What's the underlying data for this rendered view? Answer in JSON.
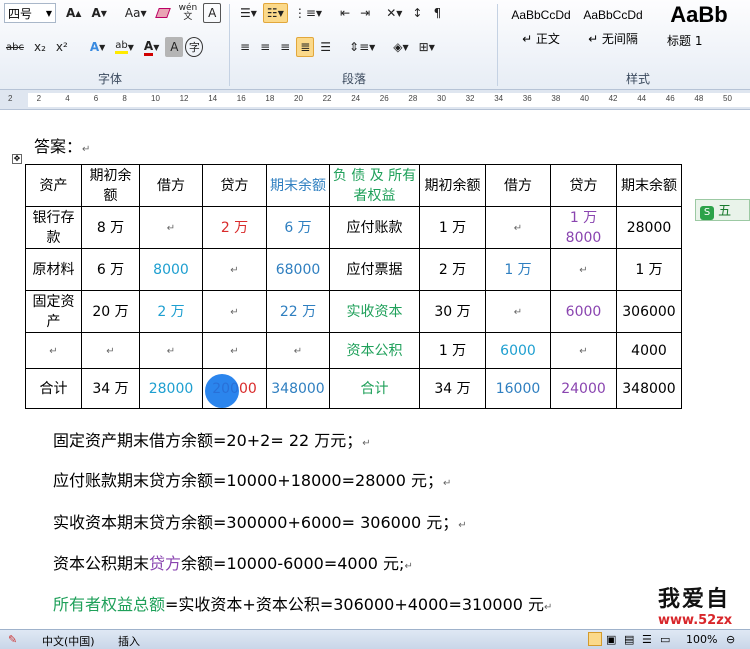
{
  "ribbon": {
    "font_size": "四号",
    "group_font": "字体",
    "group_paragraph": "段落",
    "group_styles": "样式",
    "styles": [
      {
        "sample": "AaBbCcDd",
        "name": "↵ 正文"
      },
      {
        "sample": "AaBbCcDd",
        "name": "↵ 无间隔"
      },
      {
        "sample": "AaBb",
        "name": "标题 1"
      }
    ],
    "buttons": {
      "grow_font": "A",
      "shrink_font": "A",
      "change_case": "Aa",
      "wen": "wén",
      "char_border": "A",
      "strike": "abc",
      "subscript": "x₂",
      "superscript": "x²",
      "text_effect": "A",
      "font_color": "A",
      "char_shade": "A",
      "enclose": "字",
      "highlight": "ab"
    }
  },
  "ruler": {
    "ticks": [
      "2",
      "2",
      "4",
      "6",
      "8",
      "10",
      "12",
      "14",
      "16",
      "18",
      "20",
      "22",
      "24",
      "26",
      "28",
      "30",
      "32",
      "34",
      "36",
      "38",
      "40",
      "42",
      "44",
      "46",
      "48",
      "50"
    ]
  },
  "doc": {
    "answer_label": "答案：",
    "table": {
      "header": [
        "资产",
        "期初余额",
        "借方",
        "贷方",
        "期末余额",
        "负 债 及 所有者权益",
        "期初余额",
        "借方",
        "贷方",
        "期末余额"
      ],
      "rows": [
        [
          "银行存款",
          "8 万",
          "",
          "2 万",
          "6 万",
          "应付账款",
          "1 万",
          "",
          "1 万 8000",
          "28000"
        ],
        [
          "原材料",
          "6 万",
          "8000",
          "",
          "68000",
          "应付票据",
          "2 万",
          "1 万",
          "",
          "1 万"
        ],
        [
          "固定资产",
          "20 万",
          "2 万",
          "",
          "22 万",
          "实收资本",
          "30 万",
          "",
          "6000",
          "306000"
        ],
        [
          "",
          "",
          "",
          "",
          "",
          "资本公积",
          "1 万",
          "6000",
          "",
          "4000"
        ],
        [
          "合计",
          "34 万",
          "28000",
          "20000",
          "348000",
          "合计",
          "34 万",
          "16000",
          "24000",
          "348000"
        ]
      ]
    },
    "lines": [
      "固定资产期末借方余额=20+2= 22 万元；",
      "应付账款期末贷方余额=10000+18000=28000 元；",
      "实收资本期末贷方余额=300000+6000= 306000 元；",
      "资本公积期末贷方余额=10000-6000=4000 元;",
      "所有者权益总额=实收资本+资本公积=306000+4000=310000 元"
    ],
    "side_tag": "五",
    "watermark": "我爱自",
    "watermark_url": "www.52zx"
  },
  "statusbar": {
    "language": "中文(中国)",
    "insert": "插入",
    "zoom": "100%"
  },
  "colors": {
    "red": "#d92b2b",
    "blue": "#2f7fc0",
    "teal": "#1e9fd0",
    "green": "#1fa05a",
    "purple": "#8a45b0",
    "active_button": "#fbd98a"
  }
}
